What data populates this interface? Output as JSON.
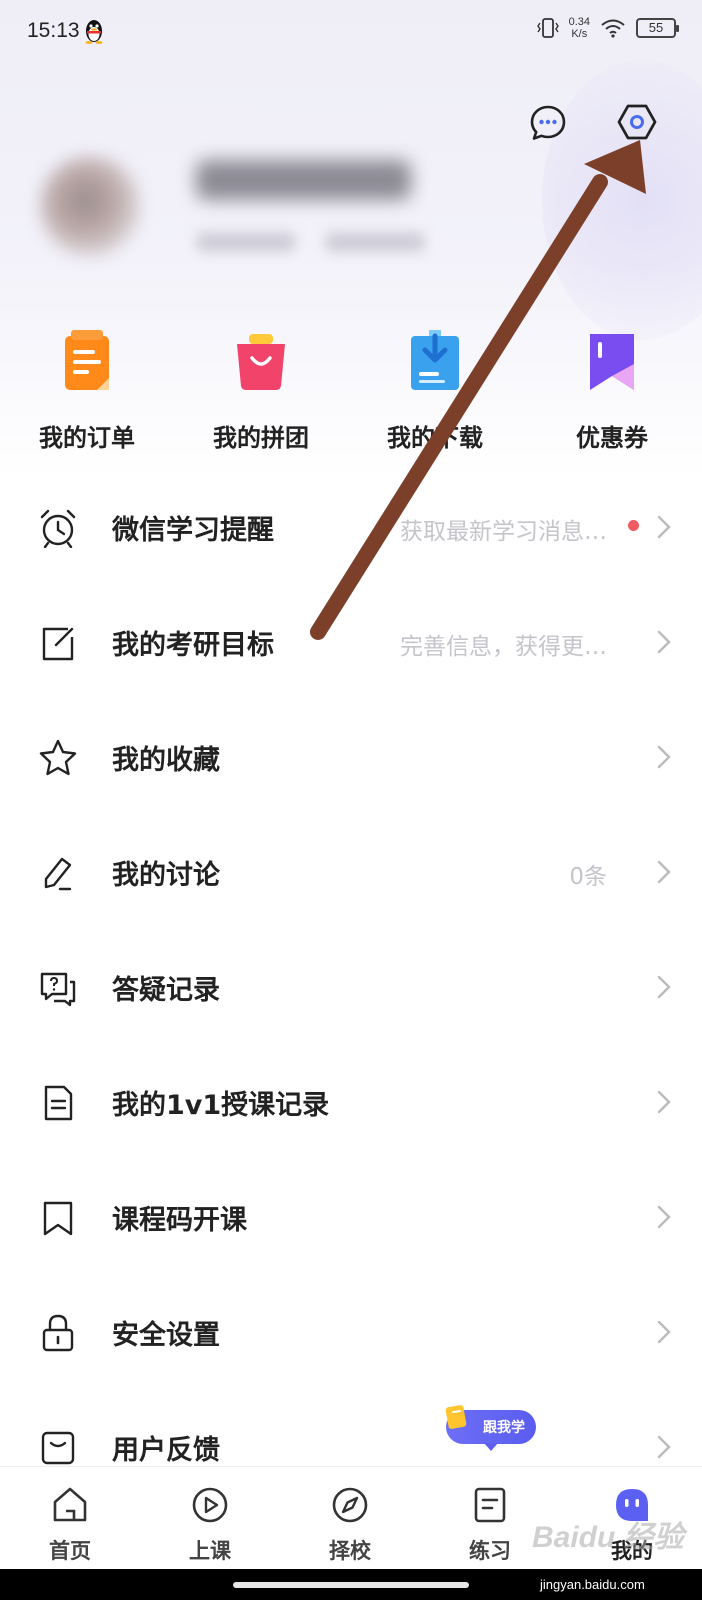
{
  "status_bar": {
    "time": "15:13",
    "net_speed_value": "0.34",
    "net_speed_unit": "K/s",
    "battery": "55"
  },
  "header": {
    "message_icon": "chat-bubble-icon",
    "settings_icon": "settings-hexagon-icon"
  },
  "quick_actions": [
    {
      "label": "我的订单",
      "icon": "order-icon",
      "color": "#ff8a1a"
    },
    {
      "label": "我的拼团",
      "icon": "group-buy-bag-icon",
      "color": "#f2436b"
    },
    {
      "label": "我的下载",
      "icon": "download-icon",
      "color": "#3aa1ee"
    },
    {
      "label": "优惠券",
      "icon": "coupon-icon",
      "color": "#7a4df0"
    }
  ],
  "menu": [
    {
      "label": "微信学习提醒",
      "hint": "获取最新学习消息…",
      "icon": "alarm-clock-icon",
      "dot": true
    },
    {
      "label": "我的考研目标",
      "hint": "完善信息，获得更…",
      "icon": "edit-square-icon",
      "dot": false
    },
    {
      "label": "我的收藏",
      "hint": "",
      "icon": "star-icon",
      "dot": false
    },
    {
      "label": "我的讨论",
      "hint": "0条",
      "icon": "pen-icon",
      "dot": false
    },
    {
      "label": "答疑记录",
      "hint": "",
      "icon": "qa-chat-icon",
      "dot": false
    },
    {
      "label": "我的1v1授课记录",
      "hint": "",
      "icon": "document-icon",
      "dot": false
    },
    {
      "label": "课程码开课",
      "hint": "",
      "icon": "bookmark-icon",
      "dot": false
    },
    {
      "label": "安全设置",
      "hint": "",
      "icon": "lock-icon",
      "dot": false
    },
    {
      "label": "用户反馈",
      "hint": "",
      "icon": "feedback-icon",
      "dot": false
    }
  ],
  "follow_badge": "跟我学",
  "tabs": [
    {
      "label": "首页",
      "icon": "home-icon"
    },
    {
      "label": "上课",
      "icon": "play-icon"
    },
    {
      "label": "择校",
      "icon": "compass-icon"
    },
    {
      "label": "练习",
      "icon": "exercise-icon"
    },
    {
      "label": "我的",
      "icon": "profile-face-icon",
      "active": true
    }
  ],
  "colors": {
    "accent": "#5b5ff2",
    "annotation_arrow": "#7b3f2a",
    "red_dot": "#f25b62"
  },
  "watermark": {
    "logo": "Baidu 经验",
    "url": "jingyan.baidu.com"
  }
}
